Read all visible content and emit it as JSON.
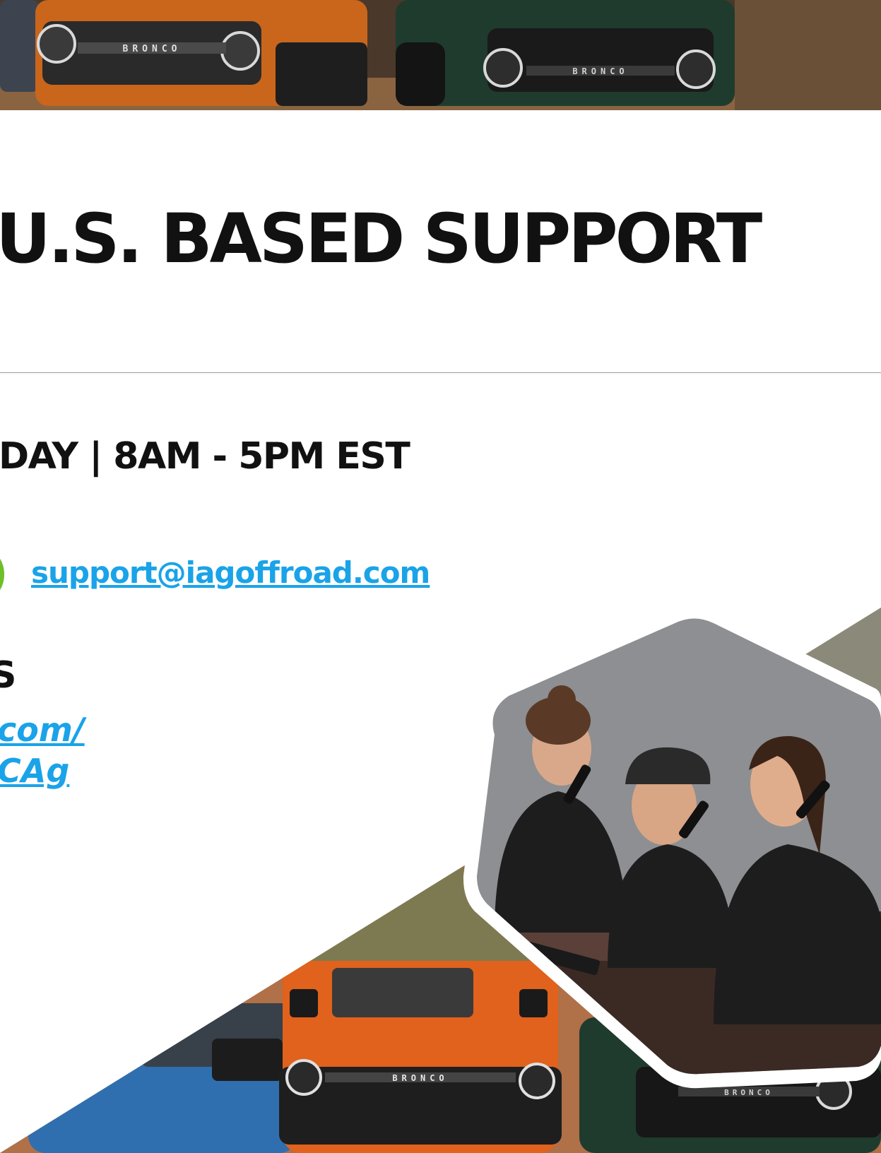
{
  "heading": "U.S. BASED SUPPORT",
  "hours_line": "DAY | 8AM - 5PM EST",
  "email": {
    "address": "support@iagoffroad.com",
    "icon": "email-icon"
  },
  "side_section": {
    "heading_fragment": "S",
    "link_line_1": "com/",
    "link_line_2": "CAg"
  },
  "banner_grille_text": [
    "BRONCO",
    "BRONCO"
  ],
  "collage_grille_text": [
    "BRONCO",
    "BRONCO"
  ],
  "colors": {
    "link": "#1aa3e8",
    "email_icon": "#6fbf27",
    "heading": "#111111"
  }
}
